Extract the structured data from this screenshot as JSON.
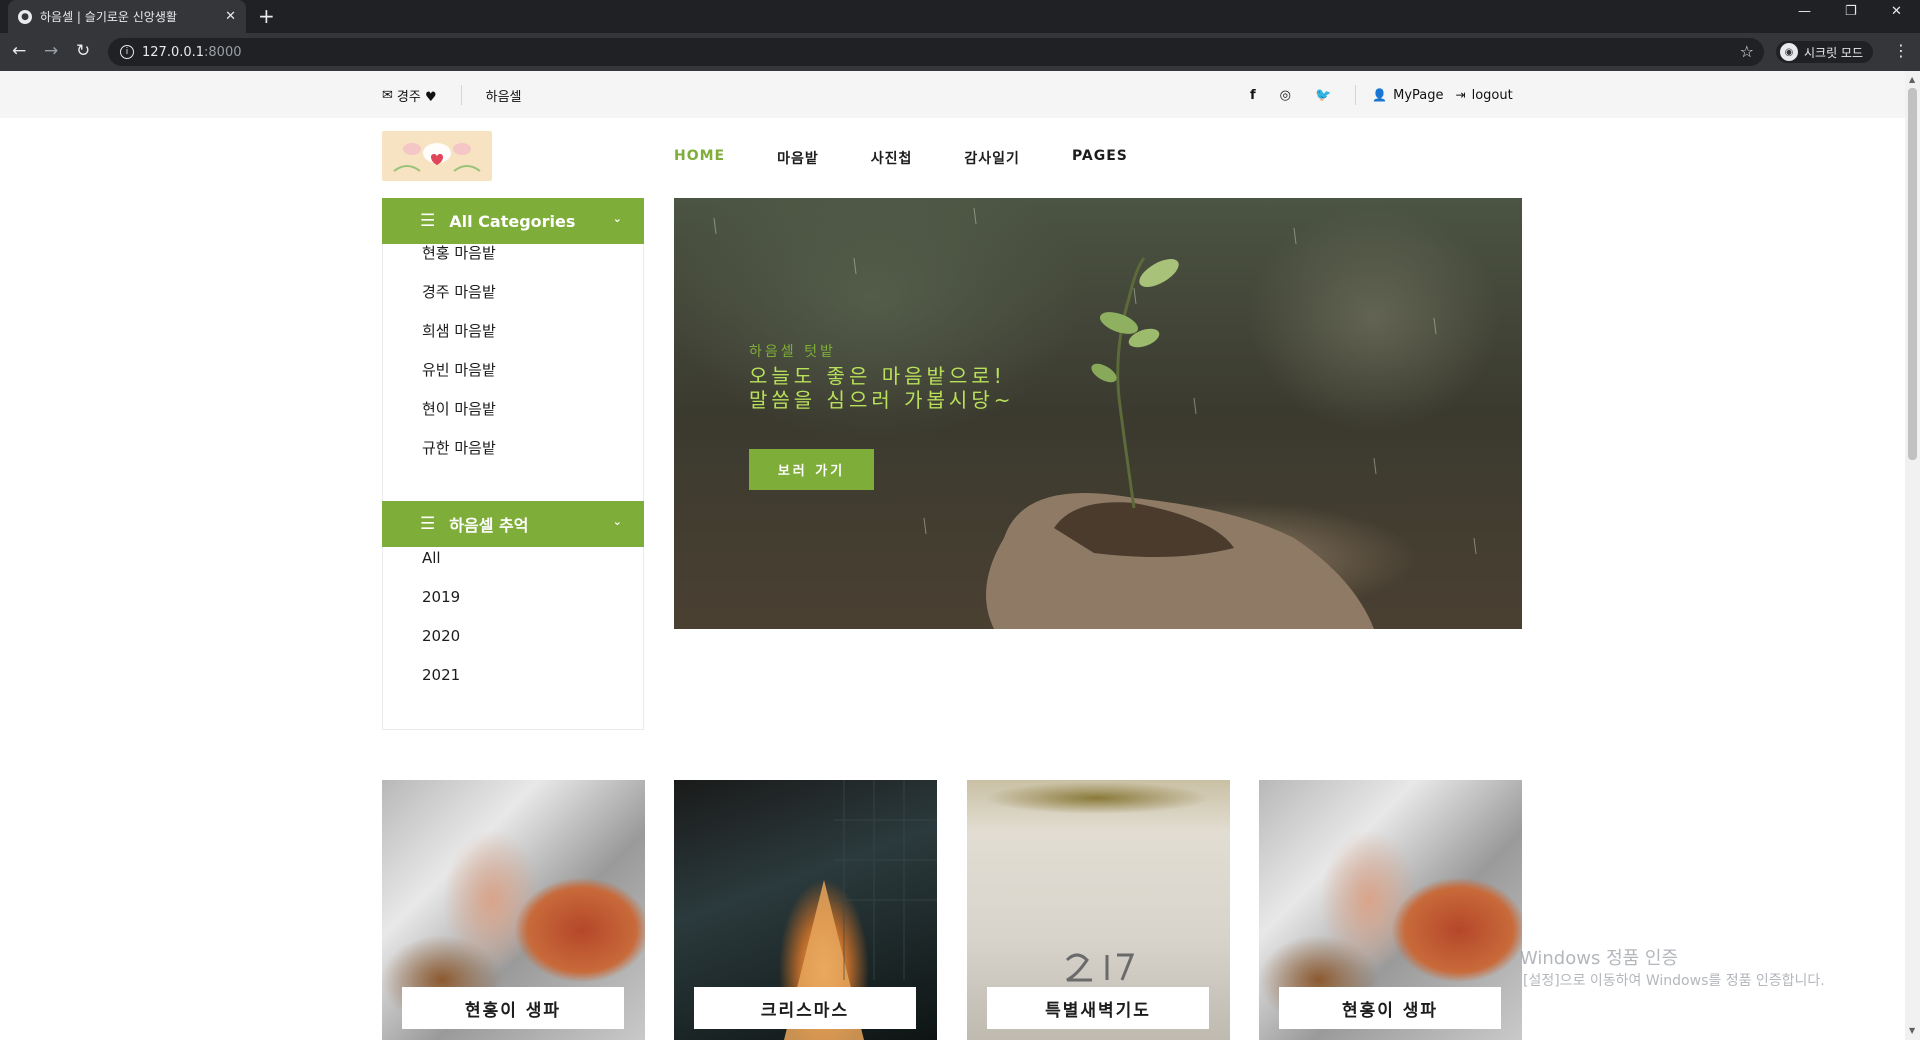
{
  "browser": {
    "tab_title": "하음셀 | 슬기로운 신앙생활",
    "tab_close": "✕",
    "new_tab": "+",
    "url_host": "127.0.0.1",
    "url_port": ":8000",
    "incognito_label": "시크릿 모드",
    "window_controls": [
      "—",
      "❐",
      "✕"
    ]
  },
  "header_top": {
    "contact": "경주 ♥",
    "brand": "하음셀",
    "mypage": "MyPage",
    "logout": "logout",
    "social_icons": [
      "facebook-icon",
      "instagram-icon",
      "twitter-icon"
    ]
  },
  "nav": {
    "items": [
      "HOME",
      "마음밭",
      "사진첩",
      "감사일기",
      "PAGES"
    ]
  },
  "sidebar": {
    "categories_title": "All Categories",
    "categories": [
      "현홍 마음밭",
      "경주 마음밭",
      "희샘 마음밭",
      "유빈 마음밭",
      "현이 마음밭",
      "규한 마음밭"
    ],
    "memories_title": "하음셀 추억",
    "memories": [
      "All",
      "2019",
      "2020",
      "2021"
    ]
  },
  "hero": {
    "subtitle": "하음셀 텃밭",
    "title_line1": "오늘도 좋은 마음밭으로!",
    "title_line2": "말씀을 심으러 가봅시당~",
    "button": "보러 가기"
  },
  "cards": [
    {
      "label": "현홍이 생파"
    },
    {
      "label": "크리스마스"
    },
    {
      "label": "특별새벽기도"
    },
    {
      "label": "현홍이 생파"
    }
  ],
  "watermark": {
    "line1": "Windows 정품 인증",
    "line2": "[설정]으로 이동하여 Windows를 정품 인증합니다."
  },
  "colors": {
    "accent": "#7fad39",
    "hero_text": "#b9e05a"
  }
}
